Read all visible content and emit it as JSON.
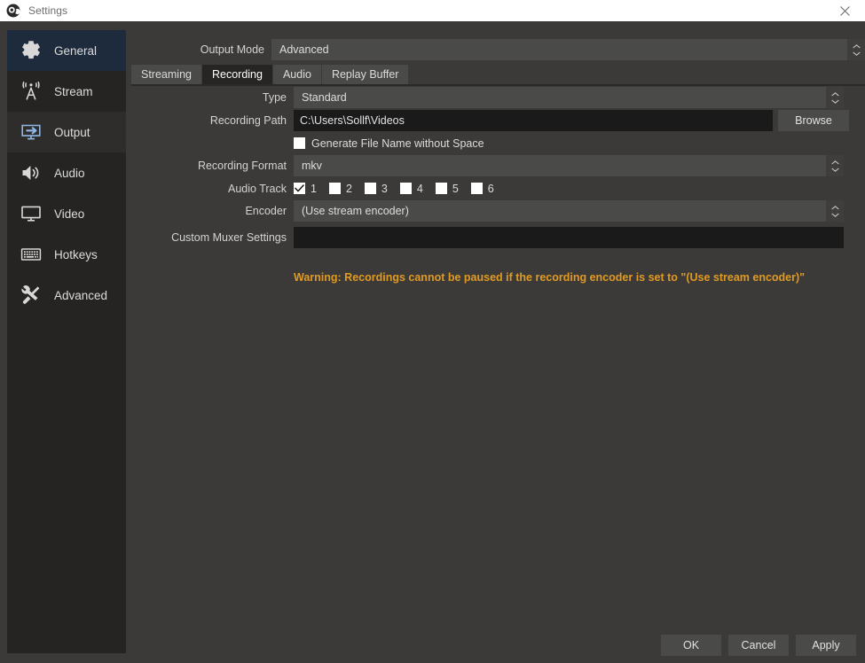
{
  "window": {
    "title": "Settings",
    "logo_icon": "obs-logo-icon",
    "close_icon": "close-icon"
  },
  "sidebar": {
    "items": [
      {
        "label": "General",
        "icon": "gear-icon",
        "state": "sel-blue"
      },
      {
        "label": "Stream",
        "icon": "broadcast-icon",
        "state": ""
      },
      {
        "label": "Output",
        "icon": "monitor-arrow-icon",
        "state": "sel-gray"
      },
      {
        "label": "Audio",
        "icon": "speaker-icon",
        "state": ""
      },
      {
        "label": "Video",
        "icon": "display-icon",
        "state": ""
      },
      {
        "label": "Hotkeys",
        "icon": "keyboard-icon",
        "state": ""
      },
      {
        "label": "Advanced",
        "icon": "tools-icon",
        "state": ""
      }
    ]
  },
  "output_mode": {
    "label": "Output Mode",
    "value": "Advanced"
  },
  "tabs": [
    {
      "label": "Streaming",
      "active": false
    },
    {
      "label": "Recording",
      "active": true
    },
    {
      "label": "Audio",
      "active": false
    },
    {
      "label": "Replay Buffer",
      "active": false
    }
  ],
  "recording": {
    "type": {
      "label": "Type",
      "value": "Standard"
    },
    "recording_path": {
      "label": "Recording Path",
      "value": "C:\\Users\\Sollf\\Videos",
      "browse_label": "Browse"
    },
    "generate_no_space": {
      "label": "Generate File Name without Space",
      "checked": false
    },
    "recording_format": {
      "label": "Recording Format",
      "value": "mkv"
    },
    "audio_track": {
      "label": "Audio Track",
      "tracks": [
        {
          "num": "1",
          "checked": true
        },
        {
          "num": "2",
          "checked": false
        },
        {
          "num": "3",
          "checked": false
        },
        {
          "num": "4",
          "checked": false
        },
        {
          "num": "5",
          "checked": false
        },
        {
          "num": "6",
          "checked": false
        }
      ]
    },
    "encoder": {
      "label": "Encoder",
      "value": "(Use stream encoder)"
    },
    "custom_muxer": {
      "label": "Custom Muxer Settings",
      "value": ""
    },
    "warning": "Warning: Recordings cannot be paused if the recording encoder is set to \"(Use stream encoder)\""
  },
  "buttons": {
    "ok": "OK",
    "cancel": "Cancel",
    "apply": "Apply"
  },
  "colors": {
    "background": "#3b3a38",
    "sidebar": "#252423",
    "selected_blue": "#1d2b3d",
    "selected_gray": "#2e2d2c",
    "combo": "#4a4a48",
    "input": "#1a1a1a",
    "warning": "#e09a22",
    "accent_icon": "#8fb6e4"
  }
}
